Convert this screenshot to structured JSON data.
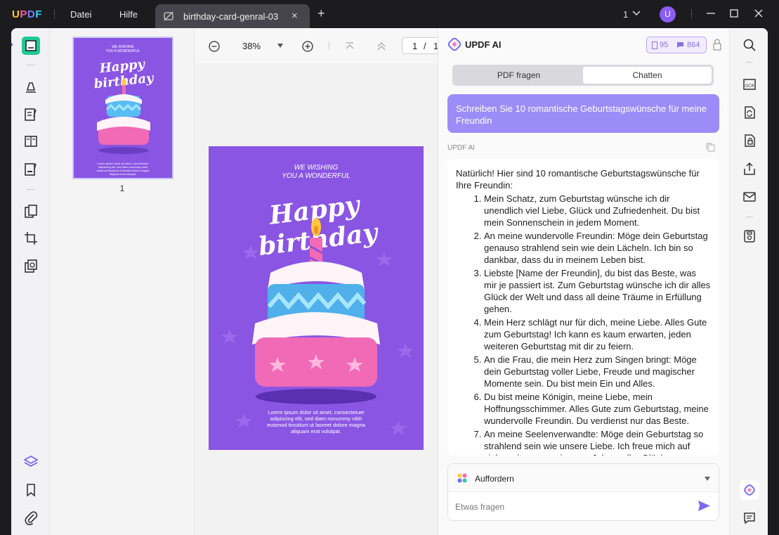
{
  "app": {
    "logo": "UPDF"
  },
  "menu": {
    "file": "Datei",
    "help": "Hilfe"
  },
  "tab": {
    "name": "birthday-card-genral-03",
    "close": "×",
    "new": "+"
  },
  "window": {
    "count": "1",
    "avatar": "U"
  },
  "thumbnail": {
    "page_number": "1"
  },
  "viewer": {
    "zoom": "38%",
    "page_current": "1",
    "page_sep": "/",
    "page_total": "1"
  },
  "card": {
    "top_line1": "WE WISHING",
    "top_line2": "YOU A WONDERFUL",
    "headline": "Happy birthday",
    "footer": "Lorem ipsum dolor sit amet, consectetuer adipiscing elit, sed diam nonummy nibh euismod tincidunt ut laoreet dolore magna aliquam erat volutpat."
  },
  "ai": {
    "title": "UPDF AI",
    "credits_a": "95",
    "credits_b": "864",
    "tab_pdf": "PDF fragen",
    "tab_chat": "Chatten",
    "user_message": "Schreiben Sie 10 romantische Geburtstagswünsche für meine Freundin",
    "label": "UPDF AI",
    "intro": "Natürlich! Hier sind 10 romantische Geburtstagswünsche für Ihre Freundin:",
    "items": [
      "Mein Schatz, zum Geburtstag wünsche ich dir unendlich viel Liebe, Glück und Zufriedenheit. Du bist mein Sonnenschein in jedem Moment.",
      "An meine wundervolle Freundin: Möge dein Geburtstag genauso strahlend sein wie dein Lächeln. Ich bin so dankbar, dass du in meinem Leben bist.",
      "Liebste [Name der Freundin], du bist das Beste, was mir je passiert ist. Zum Geburtstag wünsche ich dir alles Glück der Welt und dass all deine Träume in Erfüllung gehen.",
      "Mein Herz schlägt nur für dich, meine Liebe. Alles Gute zum Geburtstag! Ich kann es kaum erwarten, jeden weiteren Geburtstag mit dir zu feiern.",
      "An die Frau, die mein Herz zum Singen bringt: Möge dein Geburtstag voller Liebe, Freude und magischer Momente sein. Du bist mein Ein und Alles.",
      "Du bist meine Königin, meine Liebe, mein Hoffnungsschimmer. Alles Gute zum Geburtstag, meine wundervolle Freundin. Du verdienst nur das Beste.",
      "An meine Seelenverwandte: Möge dein Geburtstag so strahlend sein wie unsere Liebe. Ich freue mich auf viele weitere gemeinsame Jahre voller Glück."
    ],
    "prompt_label": "Auffordern",
    "input_placeholder": "Etwas fragen"
  },
  "colors": {
    "accent": "#9b8cf7",
    "card": "#8a55e3",
    "active_tool": "#1ec997"
  }
}
